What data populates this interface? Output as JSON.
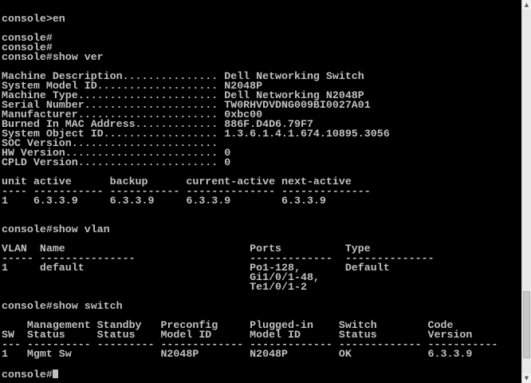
{
  "terminal": {
    "text_color": "#c0c0c0",
    "background_color": "#000000",
    "lines": [
      "console>en",
      "",
      "console#",
      "console#",
      "console#show ver",
      "",
      "Machine Description............... Dell Networking Switch",
      "System Model ID................... N2048P",
      "Machine Type...................... Dell Networking N2048P",
      "Serial Number..................... TW0RHVDVDNG009BI0027A01",
      "Manufacturer...................... 0xbc00",
      "Burned In MAC Address............. 886F.D4D6.79F7",
      "System Object ID.................. 1.3.6.1.4.1.674.10895.3056",
      "SOC Version.......................",
      "HW Version........................ 0",
      "CPLD Version...................... 0",
      "",
      "unit active      backup      current-active next-active",
      "---- ----------- ----------- -------------- --------------",
      "1    6.3.3.9     6.3.3.9     6.3.3.9        6.3.3.9",
      "",
      "",
      "console#show vlan",
      "",
      "VLAN  Name                             Ports          Type",
      "----- ---------------                  -------------  --------------",
      "1     default                          Po1-128,       Default",
      "                                       Gi1/0/1-48,",
      "                                       Te1/0/1-2",
      "",
      "console#show switch",
      "",
      "    Management Standby   Preconfig     Plugged-in    Switch        Code",
      "SW  Status     Status    Model ID      Model ID      Status        Version",
      "--- ---------- --------- ------------- ------------- ------------- -----------",
      "1   Mgmt Sw              N2048P        N2048P        OK            6.3.3.9",
      "",
      "console#"
    ]
  },
  "scrollbar": {
    "up_arrow_icon": "triangle-up-icon",
    "down_arrow_icon": "triangle-down-icon",
    "thumb_position": 0.95
  }
}
